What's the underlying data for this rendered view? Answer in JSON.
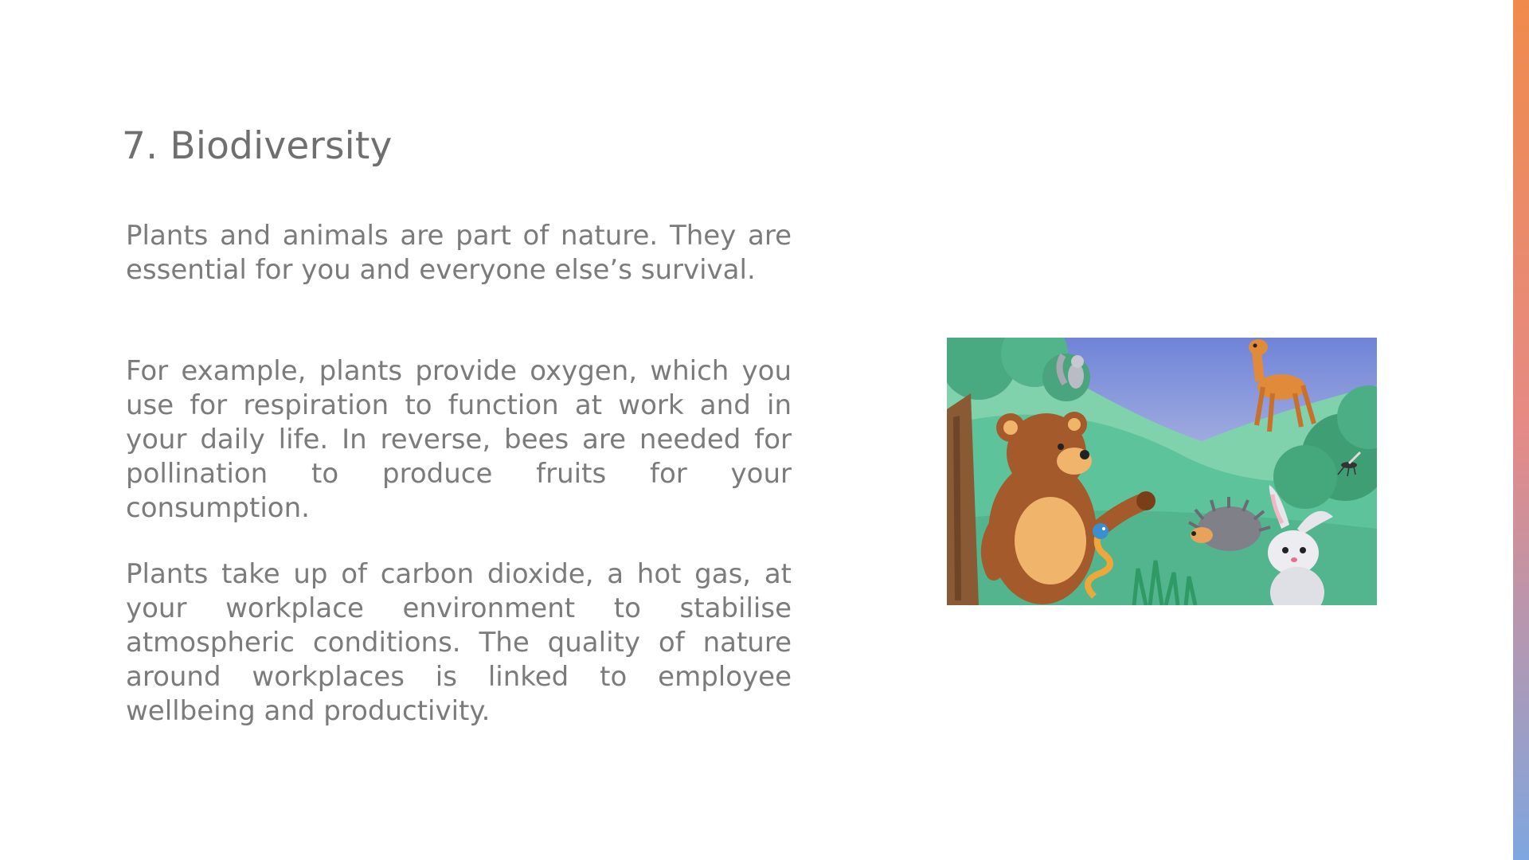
{
  "slide": {
    "title": "7. Biodiversity",
    "paragraphs": [
      "Plants and animals are part of nature.  They are essential for you and everyone else’s survival.",
      "For example, plants provide oxygen, which you use for respiration to function at work and in your daily life. In reverse, bees are needed for pollination to produce fruits for your consumption.",
      "Plants take up of carbon dioxide, a hot gas, at your workplace environment to stabilise atmospheric conditions. The quality of nature around workplaces is linked to employee wellbeing and productivity."
    ]
  },
  "illustration": {
    "subject": "cartoon-forest-animals",
    "depicted": [
      "bear-icon",
      "deer-icon",
      "rabbit-icon",
      "hedgehog-icon",
      "snake-icon",
      "squirrel-icon",
      "mosquito-icon",
      "tree-icon"
    ]
  },
  "colors": {
    "text": "#7b7b7b",
    "title": "#6f6f6f",
    "accent_top": "#f08a4b",
    "accent_bottom": "#7fa6e0",
    "meadow": "#5cc39a"
  }
}
